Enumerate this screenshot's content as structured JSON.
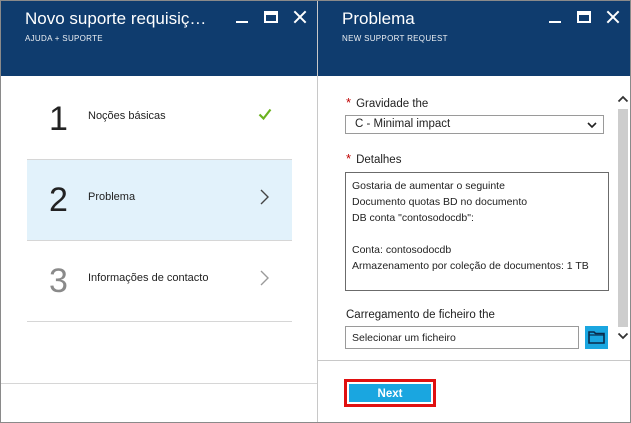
{
  "left_blade": {
    "title": "Novo suporte requisição...",
    "subtitle": "AJUDA + SUPORTE",
    "icons": [
      "minimize-icon",
      "maximize-icon",
      "close-icon"
    ],
    "steps": [
      {
        "number": "1",
        "label": "Noções básicas",
        "state": "completed",
        "icon": "check-icon"
      },
      {
        "number": "2",
        "label": "Problema",
        "state": "active",
        "icon": "chevron-right-icon"
      },
      {
        "number": "3",
        "label": "Informações de contacto",
        "state": "pending",
        "icon": "chevron-right-icon"
      }
    ]
  },
  "right_blade": {
    "title": "Problema",
    "subtitle": "NEW SUPPORT REQUEST",
    "icons": [
      "minimize-icon",
      "maximize-icon",
      "close-icon"
    ],
    "severity": {
      "required_mark": "*",
      "label": "Gravidade the",
      "selected": "C - Minimal impact"
    },
    "details": {
      "required_mark": "*",
      "label": "Detalhes",
      "value": "Gostaria de aumentar o seguinte\nDocumento quotas BD no documento\nDB conta \"contosodocdb\":\n\nConta: contosodocdb\nArmazenamento por coleção de documentos: 1 TB"
    },
    "file_upload": {
      "label": "Carregamento de ficheiro the",
      "placeholder": "Selecionar um ficheiro"
    },
    "next_label": "Next"
  },
  "colors": {
    "header_bg": "#0f3c6e",
    "accent": "#1aa6e0",
    "active_step_bg": "#e2f2fb",
    "check": "#6bb21f",
    "required": "#c00000",
    "highlight_outline": "#e01010"
  }
}
